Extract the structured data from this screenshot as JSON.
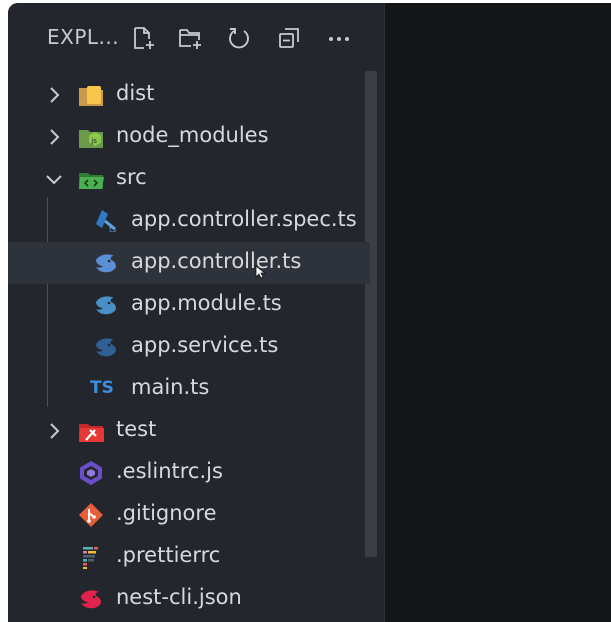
{
  "explorer": {
    "title": "EXPL...",
    "actions": [
      {
        "name": "new-file-icon"
      },
      {
        "name": "new-folder-icon"
      },
      {
        "name": "refresh-icon"
      },
      {
        "name": "collapse-all-icon"
      },
      {
        "name": "more-actions-icon"
      }
    ]
  },
  "tree": [
    {
      "label": "dist",
      "type": "folder",
      "state": "collapsed",
      "icon": "folder-dist-icon"
    },
    {
      "label": "node_modules",
      "type": "folder",
      "state": "collapsed",
      "icon": "folder-node-icon"
    },
    {
      "label": "src",
      "type": "folder",
      "state": "expanded",
      "icon": "folder-src-icon"
    },
    {
      "label": "app.controller.spec.ts",
      "type": "file",
      "icon": "test-ts-icon"
    },
    {
      "label": "app.controller.ts",
      "type": "file",
      "icon": "nest-controller-icon",
      "hovered": true
    },
    {
      "label": "app.module.ts",
      "type": "file",
      "icon": "nest-module-icon"
    },
    {
      "label": "app.service.ts",
      "type": "file",
      "icon": "nest-service-icon"
    },
    {
      "label": "main.ts",
      "type": "file",
      "icon": "typescript-icon",
      "icon_text": "TS"
    },
    {
      "label": "test",
      "type": "folder",
      "state": "collapsed",
      "icon": "folder-test-icon"
    },
    {
      "label": ".eslintrc.js",
      "type": "file",
      "icon": "eslint-icon"
    },
    {
      "label": ".gitignore",
      "type": "file",
      "icon": "git-icon"
    },
    {
      "label": ".prettierrc",
      "type": "file",
      "icon": "prettier-icon"
    },
    {
      "label": "nest-cli.json",
      "type": "file",
      "icon": "nest-cli-icon"
    }
  ],
  "colors": {
    "sidebar_bg": "#23272d",
    "editor_bg": "#141517",
    "text": "#d6dae0",
    "hover_row": "#2e333b",
    "nest_red": "#e0234e",
    "ts_blue": "#3178c6"
  }
}
